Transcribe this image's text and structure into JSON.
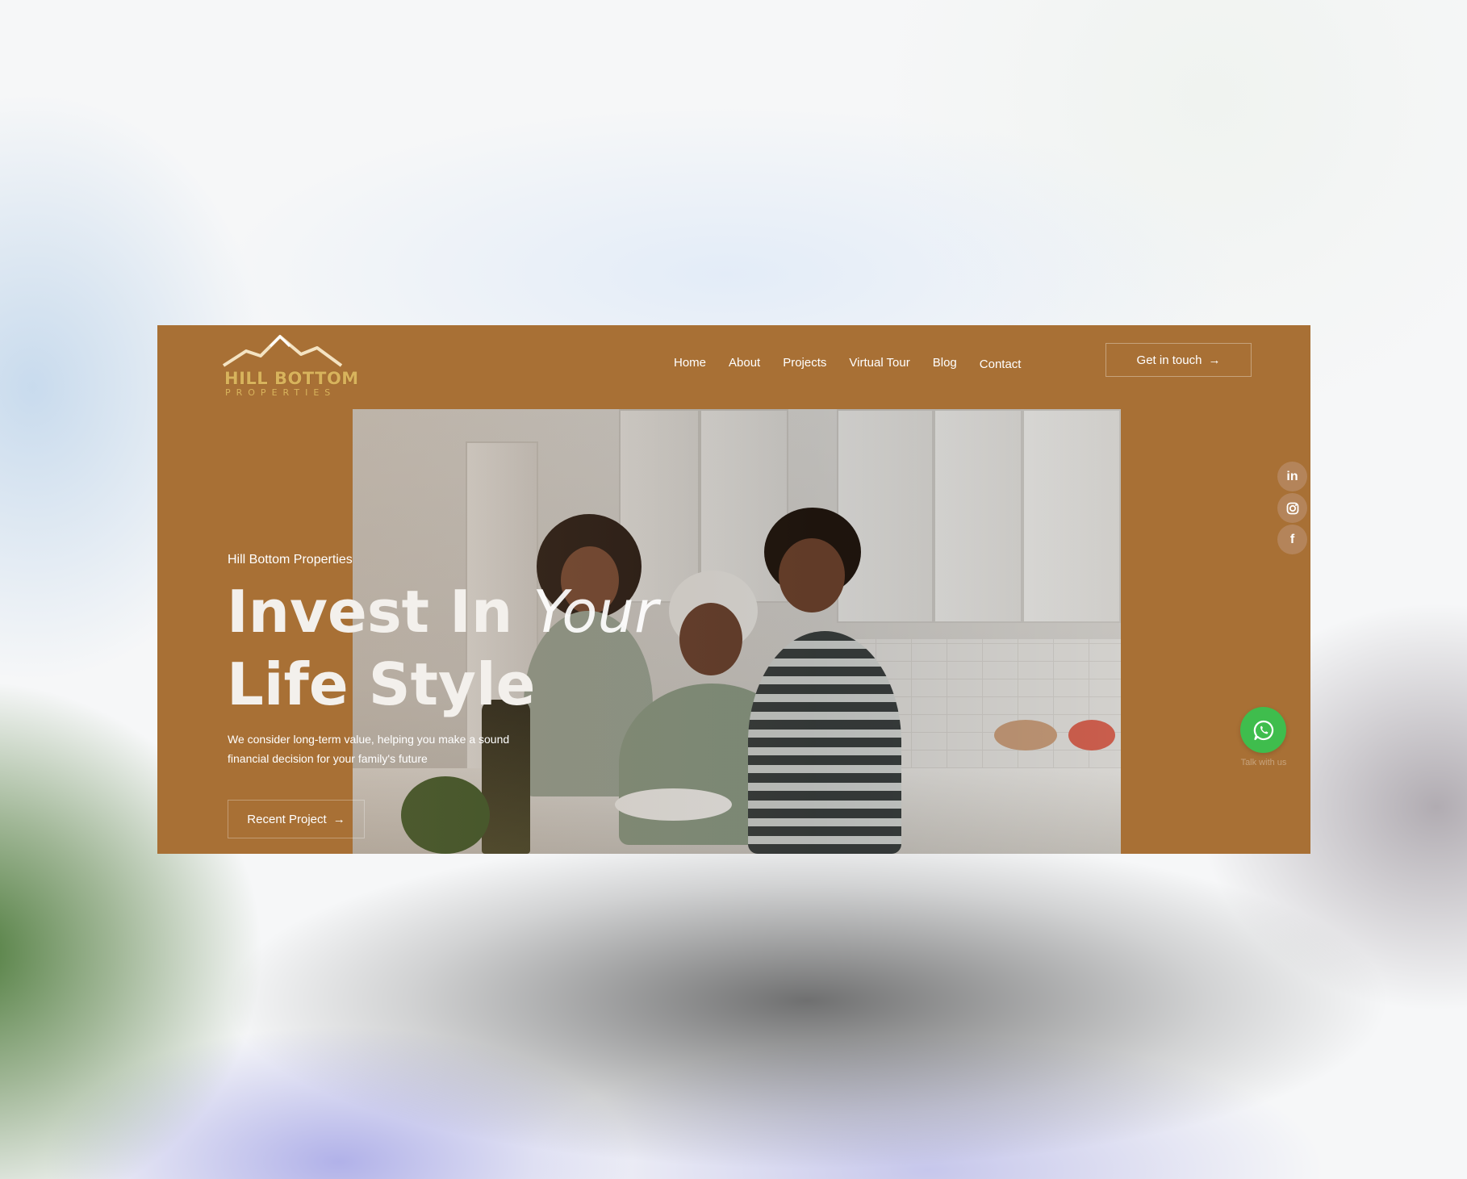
{
  "brand": {
    "name": "HILL BOTTOM",
    "subtitle": "PROPERTIES"
  },
  "nav": {
    "items": [
      {
        "label": "Home"
      },
      {
        "label": "About"
      },
      {
        "label": "Projects"
      },
      {
        "label": "Virtual Tour"
      },
      {
        "label": "Blog"
      },
      {
        "label": "Contact"
      }
    ],
    "cta_label": "Get in touch"
  },
  "hero": {
    "eyebrow": "Hill Bottom Properties",
    "headline_bold_1": "Invest In",
    "headline_light": "Your",
    "headline_bold_2": "Life Style",
    "description": "We consider long-term value, helping you make a sound financial decision for your family's future",
    "button_label": "Recent Project"
  },
  "social": {
    "icons": [
      "linkedin-icon",
      "instagram-icon",
      "facebook-icon"
    ]
  },
  "whatsapp": {
    "label": "Talk with us"
  },
  "colors": {
    "brand_brown": "#a87035",
    "logo_gold": "#d8b35c",
    "whatsapp_green": "#3fbd4d"
  }
}
